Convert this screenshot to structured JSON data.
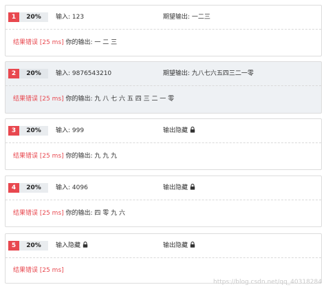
{
  "cases": [
    {
      "num": "1",
      "pct": "20%",
      "input": "输入: 123",
      "input_hidden": false,
      "expected": "期望输出: 一二三",
      "expected_hidden": false,
      "result": "结果错误 [25 ms]",
      "output": "你的输出: 一 二 三"
    },
    {
      "num": "2",
      "pct": "20%",
      "input": "输入: 9876543210",
      "input_hidden": false,
      "expected": "期望输出: 九八七六五四三二一零",
      "expected_hidden": false,
      "result": "结果错误 [25 ms]",
      "output": "你的输出: 九 八 七 六 五 四 三 二 一 零"
    },
    {
      "num": "3",
      "pct": "20%",
      "input": "输入: 999",
      "input_hidden": false,
      "expected": "输出隐藏",
      "expected_hidden": true,
      "result": "结果错误 [25 ms]",
      "output": "你的输出: 九 九 九"
    },
    {
      "num": "4",
      "pct": "20%",
      "input": "输入: 4096",
      "input_hidden": false,
      "expected": "输出隐藏",
      "expected_hidden": true,
      "result": "结果错误 [25 ms]",
      "output": "你的输出: 四 零 九 六"
    },
    {
      "num": "5",
      "pct": "20%",
      "input": "输入隐藏",
      "input_hidden": true,
      "expected": "输出隐藏",
      "expected_hidden": true,
      "result": "结果错误 [25 ms]",
      "output": ""
    }
  ],
  "watermark": "https://blog.csdn.net/qq_40318284",
  "colors": {
    "accent": "#e8484f",
    "active_bg": "#eef1f4"
  },
  "icons": {
    "lock": "lock-icon"
  }
}
